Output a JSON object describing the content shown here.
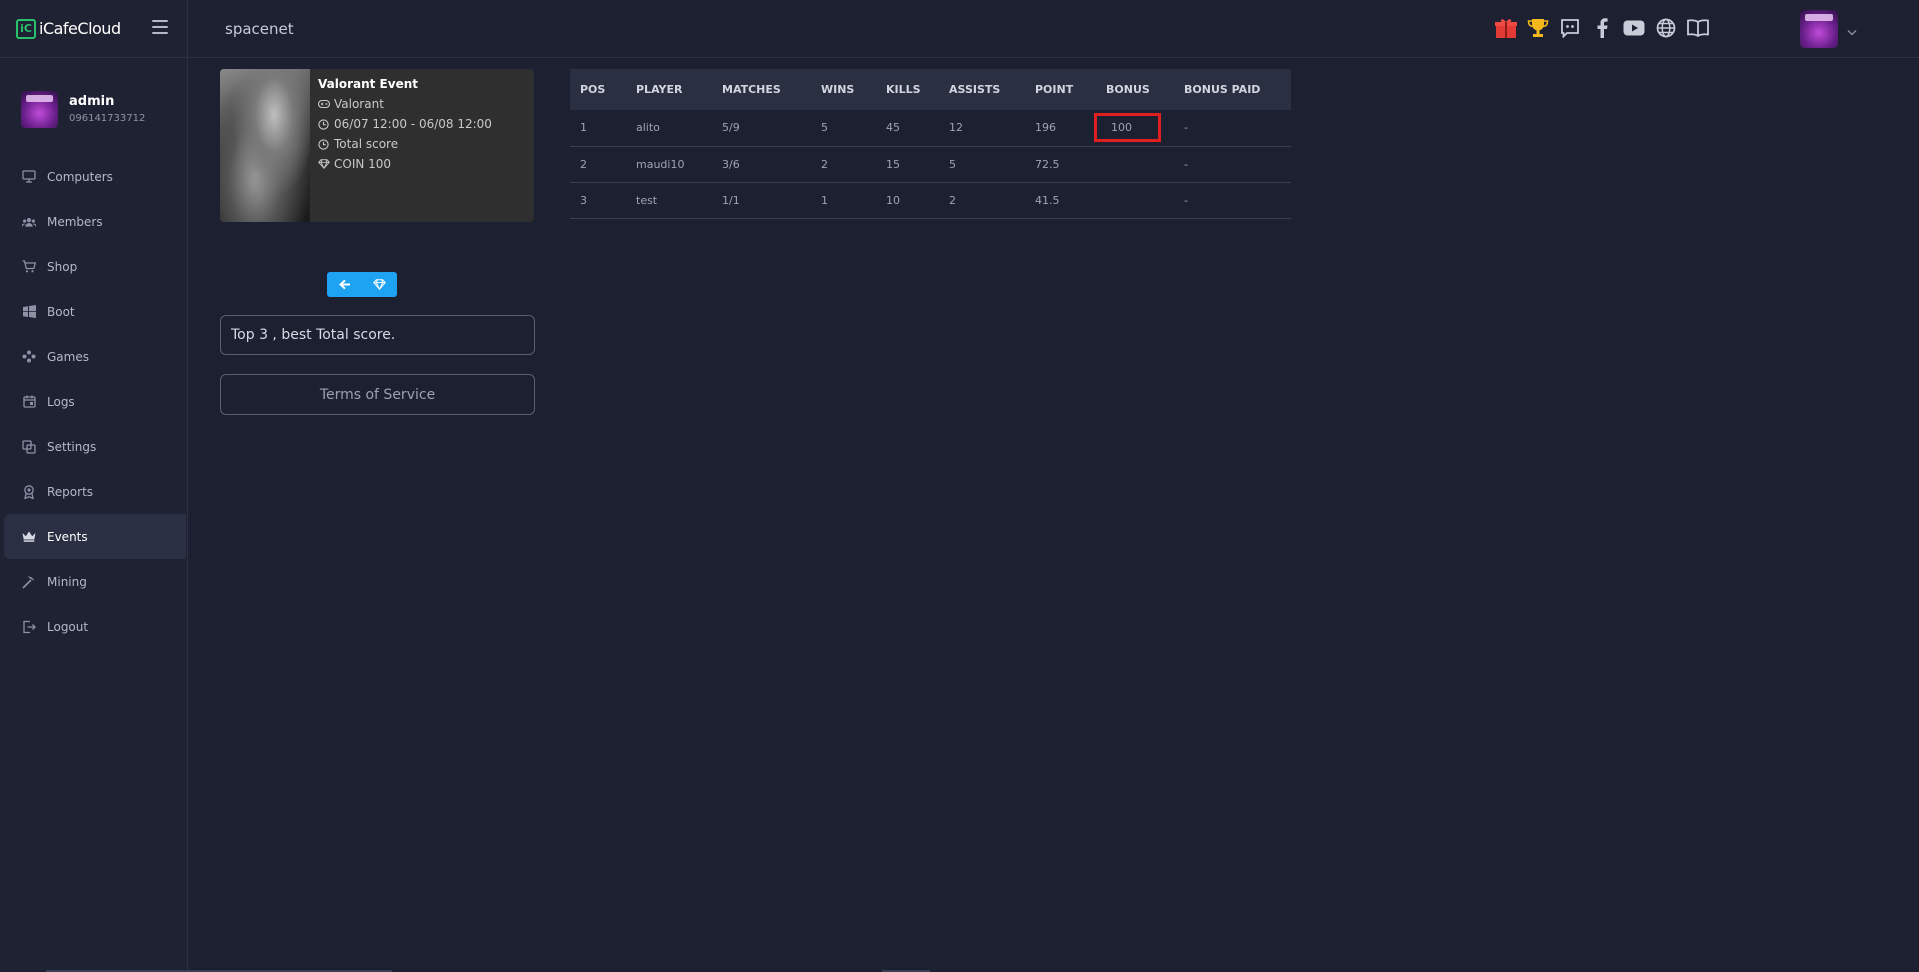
{
  "brand": {
    "logo_letter": "iC",
    "name": "iCafeCloud"
  },
  "user": {
    "name": "admin",
    "phone": "096141733712"
  },
  "nav": [
    {
      "key": "computers",
      "label": "Computers",
      "icon": "monitor-icon"
    },
    {
      "key": "members",
      "label": "Members",
      "icon": "users-icon"
    },
    {
      "key": "shop",
      "label": "Shop",
      "icon": "cart-icon"
    },
    {
      "key": "boot",
      "label": "Boot",
      "icon": "windows-icon"
    },
    {
      "key": "games",
      "label": "Games",
      "icon": "gamepad-icon"
    },
    {
      "key": "logs",
      "label": "Logs",
      "icon": "calendar-icon"
    },
    {
      "key": "settings",
      "label": "Settings",
      "icon": "settings-icon"
    },
    {
      "key": "reports",
      "label": "Reports",
      "icon": "award-icon"
    },
    {
      "key": "events",
      "label": "Events",
      "icon": "crown-icon",
      "active": true
    },
    {
      "key": "mining",
      "label": "Mining",
      "icon": "pickaxe-icon"
    },
    {
      "key": "logout",
      "label": "Logout",
      "icon": "logout-icon"
    }
  ],
  "topbar": {
    "site_name": "spacenet",
    "icons": [
      "gift-icon",
      "trophy-icon",
      "discord-icon",
      "facebook-icon",
      "youtube-icon",
      "globe-icon",
      "book-icon"
    ]
  },
  "event": {
    "title": "Valorant Event",
    "game": "Valorant",
    "period": "06/07 12:00 - 06/08 12:00",
    "scoring": "Total score",
    "prize": "COIN 100"
  },
  "description": "Top 3 , best Total score.",
  "terms_label": "Terms of Service",
  "table": {
    "columns": [
      "POS",
      "PLAYER",
      "MATCHES",
      "WINS",
      "KILLS",
      "ASSISTS",
      "POINT",
      "BONUS",
      "BONUS PAID"
    ],
    "rows": [
      [
        "1",
        "alito",
        "5/9",
        "5",
        "45",
        "12",
        "196",
        "100",
        "-"
      ],
      [
        "2",
        "maudi10",
        "3/6",
        "2",
        "15",
        "5",
        "72.5",
        "",
        "-"
      ],
      [
        "3",
        "test",
        "1/1",
        "1",
        "10",
        "2",
        "41.5",
        "",
        "-"
      ]
    ]
  },
  "colors": {
    "accent": "#1ea3f3",
    "brand_green": "#27c26b",
    "highlight_red": "#e02020",
    "background": "#1d2030"
  }
}
